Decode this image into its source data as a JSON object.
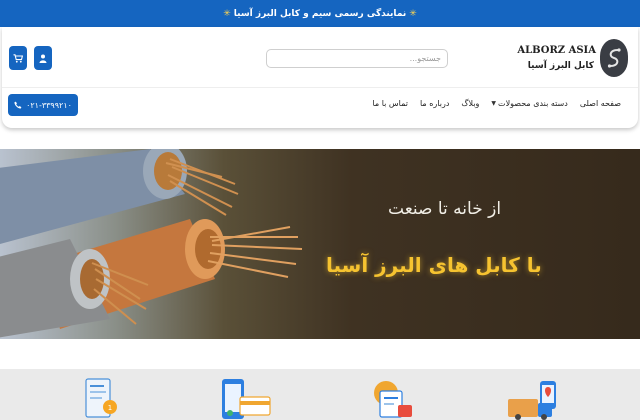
{
  "announcement": {
    "text": "نمایندگی رسمی سیم و کابل البرز آسیا",
    "left_icon": "sparkle-icon",
    "right_icon": "sparkle-icon"
  },
  "logo": {
    "name_en": "ALBORZ ASIA",
    "name_fa": "کابل البرز آسیا"
  },
  "search": {
    "placeholder": "جستجو..."
  },
  "header_actions": {
    "user_icon": "user-icon",
    "cart_icon": "cart-icon"
  },
  "nav": {
    "items": [
      {
        "label": "صفحه اصلی"
      },
      {
        "label": "دسته بندی محصولات",
        "has_dropdown": true
      },
      {
        "label": "وبلاگ"
      },
      {
        "label": "درباره ما"
      },
      {
        "label": "تماس با ما"
      }
    ]
  },
  "phone": {
    "number": "۰۲۱-۳۳۹۹۲۱۰",
    "icon": "phone-icon"
  },
  "hero": {
    "line1": "از خانه تا صنعت",
    "line2": "با کابل های البرز آسیا"
  },
  "features": {
    "icons": [
      "delivery-truck-icon",
      "payment-icon",
      "mobile-card-icon",
      "certificate-icon"
    ]
  },
  "colors": {
    "primary": "#1565c0",
    "accent_gold": "#f6c330"
  }
}
